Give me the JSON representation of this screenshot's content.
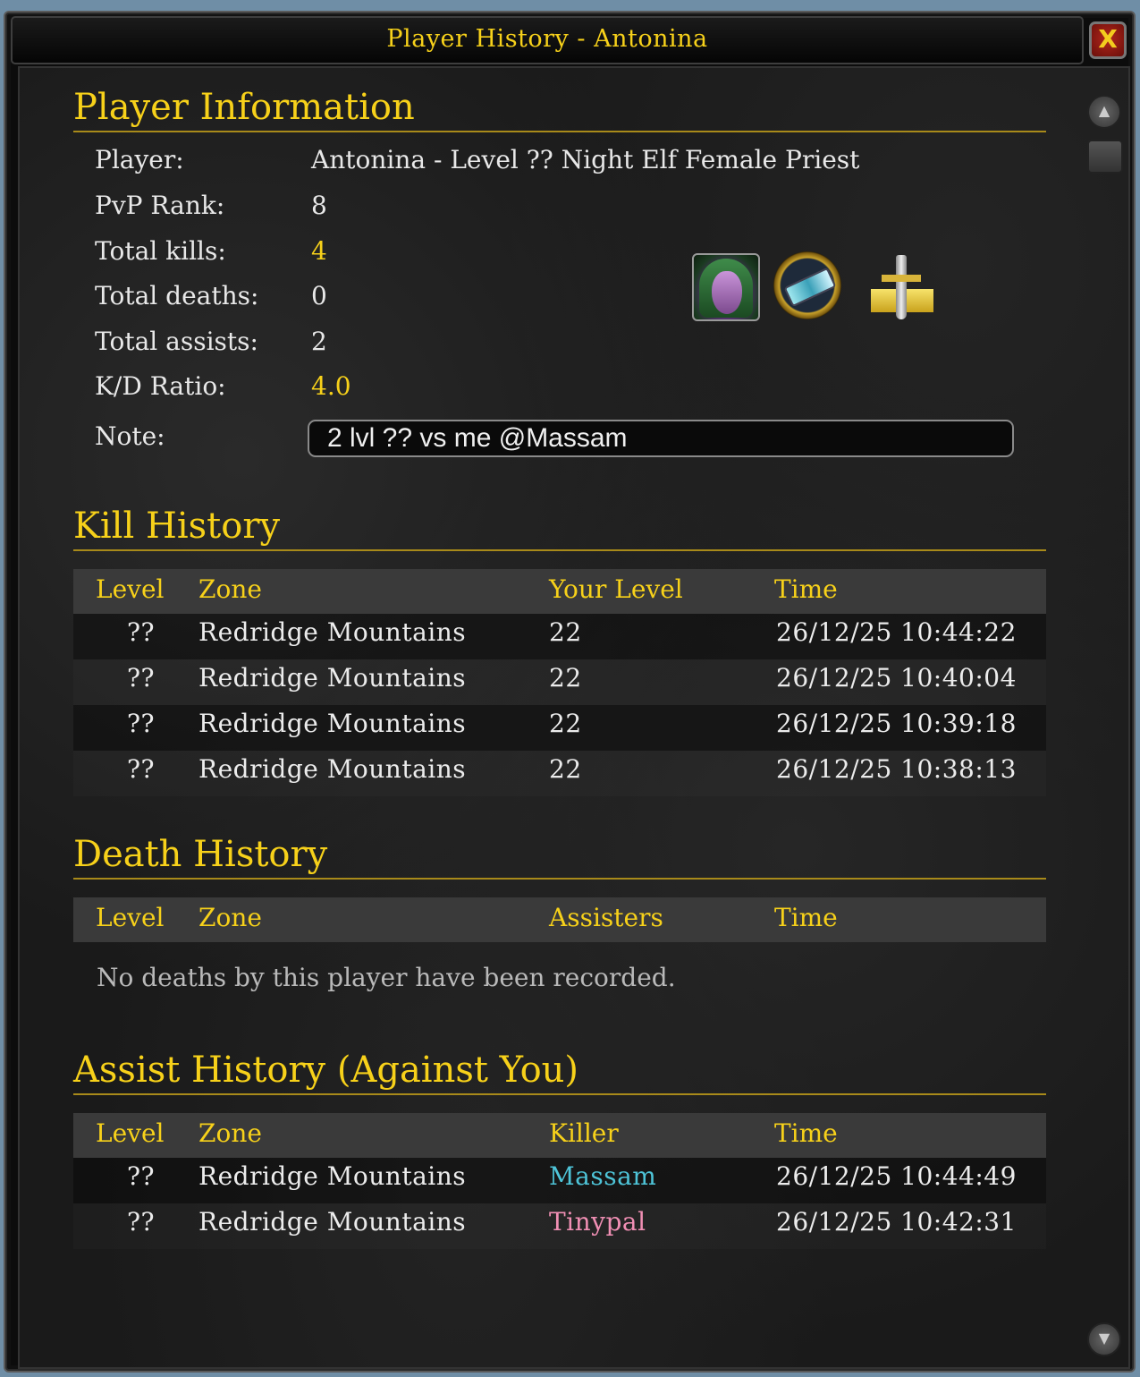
{
  "window": {
    "title": "Player History - Antonina",
    "close_label": "X"
  },
  "player_info": {
    "heading": "Player Information",
    "fields": [
      {
        "label": "Player:",
        "value": "Antonina - Level ?? Night Elf Female Priest"
      },
      {
        "label": "PvP Rank:",
        "value": "8"
      },
      {
        "label": "Total kills:",
        "value": "4"
      },
      {
        "label": "Total deaths:",
        "value": "0"
      },
      {
        "label": "Total assists:",
        "value": "2"
      },
      {
        "label": "K/D Ratio:",
        "value": "4.0"
      }
    ],
    "note_label": "Note:",
    "note_value": "2 lvl ?? vs me @Massam",
    "icons": [
      "night-elf-female-portrait-icon",
      "pvp-rank-icon",
      "alliance-faction-icon"
    ]
  },
  "kill_history": {
    "heading": "Kill History",
    "columns": [
      "Level",
      "Zone",
      "Your Level",
      "Time"
    ],
    "rows": [
      [
        "??",
        "Redridge Mountains",
        "22",
        "26/12/25 10:44:22"
      ],
      [
        "??",
        "Redridge Mountains",
        "22",
        "26/12/25 10:40:04"
      ],
      [
        "??",
        "Redridge Mountains",
        "22",
        "26/12/25 10:39:18"
      ],
      [
        "??",
        "Redridge Mountains",
        "22",
        "26/12/25 10:38:13"
      ]
    ]
  },
  "death_history": {
    "heading": "Death History",
    "columns": [
      "Level",
      "Zone",
      "Assisters",
      "Time"
    ],
    "empty_message": "No deaths by this player have been recorded."
  },
  "assist_history": {
    "heading": "Assist History (Against You)",
    "columns": [
      "Level",
      "Zone",
      "Killer",
      "Time"
    ],
    "rows": [
      [
        "??",
        "Redridge Mountains",
        "Massam",
        "26/12/25 10:44:49"
      ],
      [
        "??",
        "Redridge Mountains",
        "Tinypal",
        "26/12/25 10:42:31"
      ]
    ]
  },
  "colors": {
    "gold": "#f7d11a",
    "text": "#e8e8e8",
    "killer_massam": "#4ec4d8",
    "killer_tinypal": "#f08fb4"
  }
}
